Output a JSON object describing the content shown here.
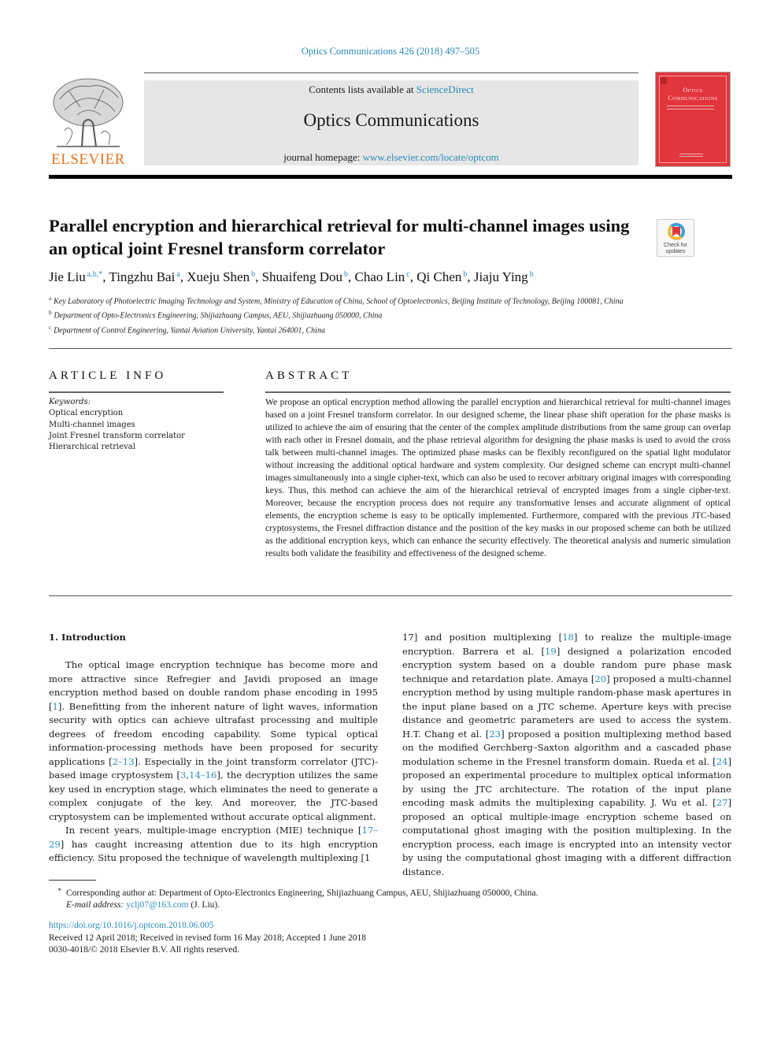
{
  "header": {
    "journal_reference": "Optics Communications 426 (2018) 497–505",
    "contents_prefix": "Contents lists available at ",
    "contents_link": "ScienceDirect",
    "journal_title": "Optics Communications",
    "homepage_prefix": "journal homepage: ",
    "homepage_link": "www.elsevier.com/locate/optcom",
    "publisher_logo_text": "ELSEVIER",
    "cover_title_line1": "Optics",
    "cover_title_line2": "Communications",
    "check_updates_line1": "Check for",
    "check_updates_line2": "updates"
  },
  "article": {
    "title": "Parallel encryption and hierarchical retrieval for multi-channel images using an optical joint Fresnel transform correlator",
    "authors": [
      {
        "name": "Jie Liu",
        "sup": "a,b,*"
      },
      {
        "name": "Tingzhu Bai",
        "sup": "a"
      },
      {
        "name": "Xueju Shen",
        "sup": "b"
      },
      {
        "name": "Shuaifeng Dou",
        "sup": "b"
      },
      {
        "name": "Chao Lin",
        "sup": "c"
      },
      {
        "name": "Qi Chen",
        "sup": "b"
      },
      {
        "name": "Jiaju Ying",
        "sup": "b"
      }
    ],
    "affiliations": [
      {
        "mark": "a",
        "text": "Key Laboratory of Photoelectric Imaging Technology and System, Ministry of Education of China, School of Optoelectronics, Beijing Institute of Technology, Beijing 100081, China"
      },
      {
        "mark": "b",
        "text": "Department of Opto-Electronics Engineering, Shijiazhuang Campus, AEU, Shijiazhuang 050000, China"
      },
      {
        "mark": "c",
        "text": "Department of Control Engineering, Yantai Aviation University, Yantai 264001, China"
      }
    ]
  },
  "article_info": {
    "heading": "ARTICLE INFO",
    "keywords_label": "Keywords:",
    "keywords": [
      "Optical encryption",
      "Multi-channel images",
      "Joint Fresnel transform correlator",
      "Hierarchical retrieval"
    ]
  },
  "abstract": {
    "heading": "ABSTRACT",
    "text": "We propose an optical encryption method allowing the parallel encryption and hierarchical retrieval for multi-channel images based on a joint Fresnel transform correlator. In our designed scheme, the linear phase shift operation for the phase masks is utilized to achieve the aim of ensuring that the center of the complex amplitude distributions from the same group can overlap with each other in Fresnel domain, and the phase retrieval algorithm for designing the phase masks is used to avoid the cross talk between multi-channel images. The optimized phase masks can be flexibly reconfigured on the spatial light modulator without increasing the additional optical hardware and system complexity. Our designed scheme can encrypt multi-channel images simultaneously into a single cipher-text, which can also be used to recover arbitrary original images with corresponding keys. Thus, this method can achieve the aim of the hierarchical retrieval of encrypted images from a single cipher-text. Moreover, because the encryption process does not require any transformative lenses and accurate alignment of optical elements, the encryption scheme is easy to be optically implemented. Furthermore, compared with the previous JTC-based cryptosystems, the Fresnel diffraction distance and the position of the key masks in our proposed scheme can both be utilized as the additional encryption keys, which can enhance the security effectively. The theoretical analysis and numeric simulation results both validate the feasibility and effectiveness of the designed scheme."
  },
  "introduction": {
    "heading": "1.  Introduction",
    "p1": [
      {
        "t": "The optical image encryption technique has become more and more attractive since Refregier and Javidi proposed an image encryption method based on double random phase encoding in 1995 ["
      },
      {
        "t": "1",
        "ref": true
      },
      {
        "t": "]. Benefitting from the inherent nature of light waves, information security with optics can achieve ultrafast processing and multiple degrees of freedom encoding capability. Some typical optical information-processing methods have been proposed for security applications ["
      },
      {
        "t": "2–13",
        "ref": true
      },
      {
        "t": "]. Especially in the joint transform correlator (JTC)-based image cryptosystem ["
      },
      {
        "t": "3",
        "ref": true
      },
      {
        "t": ","
      },
      {
        "t": "14–16",
        "ref": true
      },
      {
        "t": "], the decryption utilizes the same key used in encryption stage, which eliminates the need to generate a complex conjugate of the key. And moreover, the JTC-based cryptosystem can be implemented without accurate optical alignment."
      }
    ],
    "p2": [
      {
        "t": "In recent years, multiple-image encryption (MIE) technique ["
      },
      {
        "t": "17–29",
        "ref": true
      },
      {
        "t": "] has caught increasing attention due to its high encryption efficiency. Situ proposed the technique of wavelength multiplexing ["
      },
      {
        "t": "17",
        "ref": true
      },
      {
        "t": "] and position multiplexing ["
      },
      {
        "t": "18",
        "ref": true
      },
      {
        "t": "] to realize the multiple-image encryption. Barrera et al. ["
      },
      {
        "t": "19",
        "ref": true
      },
      {
        "t": "] designed a polarization encoded encryption system based on a double random pure phase mask technique and retardation plate. Amaya ["
      },
      {
        "t": "20",
        "ref": true
      },
      {
        "t": "] proposed a multi-channel encryption method by using multiple random-phase mask apertures in the input plane based on a JTC scheme. Aperture keys with precise distance and geometric parameters are used to access the system. H.T. Chang et al. ["
      },
      {
        "t": "23",
        "ref": true
      },
      {
        "t": "] proposed a position multiplexing method based on the modified Gerchberg–Saxton algorithm and a cascaded phase modulation scheme in the Fresnel transform domain. Rueda et al. ["
      },
      {
        "t": "24",
        "ref": true
      },
      {
        "t": "] proposed an experimental procedure to multiplex optical information by using the JTC architecture. The rotation of the input plane encoding mask admits the multiplexing capability. J. Wu et al. ["
      },
      {
        "t": "27",
        "ref": true
      },
      {
        "t": "] proposed an optical multiple-image encryption scheme based on computational ghost imaging with the position multiplexing. In the encryption process, each image is encrypted into an intensity vector by using the computational ghost imaging with a different diffraction distance."
      }
    ]
  },
  "footnote": {
    "star": "*",
    "corresponding": "Corresponding author at: Department of Opto-Electronics Engineering, Shijiazhuang Campus, AEU, Shijiazhuang 050000, China.",
    "email_label": "E-mail address:",
    "email": "yclj07@163.com",
    "email_suffix": " (J. Liu)."
  },
  "pubinfo": {
    "doi": "https://doi.org/10.1016/j.optcom.2018.06.005",
    "dates": "Received 12 April 2018; Received in revised form 16 May 2018; Accepted 1 June 2018",
    "copyright": "0030-4018/© 2018 Elsevier B.V. All rights reserved."
  }
}
